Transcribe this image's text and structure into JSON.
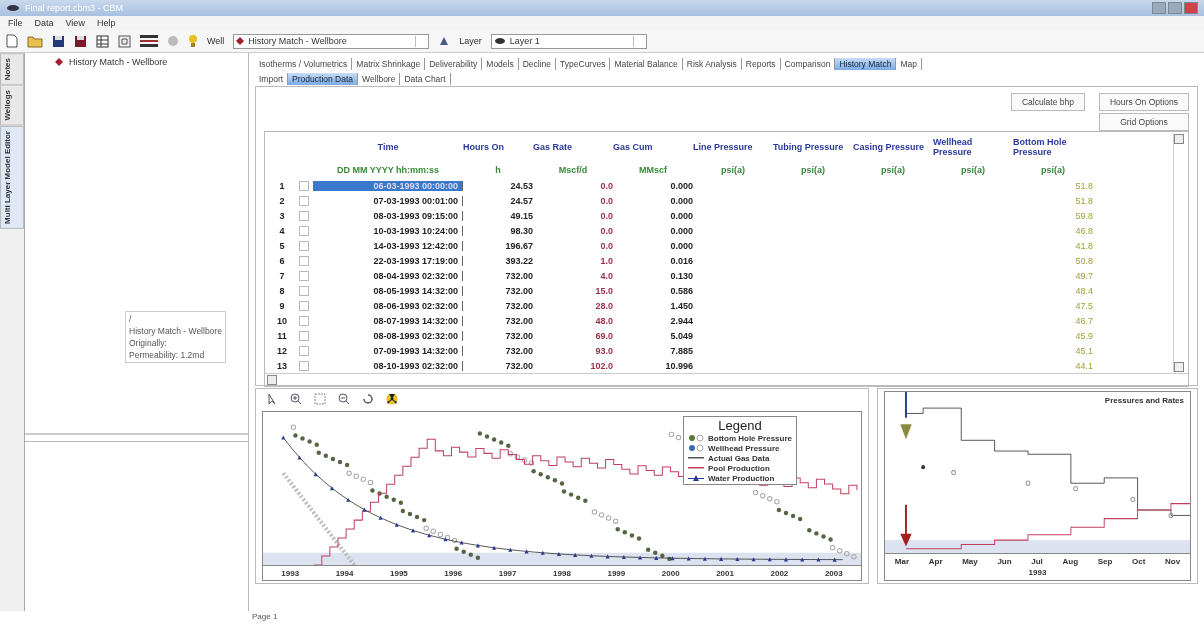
{
  "window": {
    "title": "Final report.cbm3 - CBM"
  },
  "menu": [
    "File",
    "Data",
    "View",
    "Help"
  ],
  "well_bar": {
    "well_label": "Well",
    "well_value": "History Match - Wellbore",
    "layer_label": "Layer",
    "layer_value": "Layer 1"
  },
  "side_tabs": [
    {
      "label": "Notes",
      "selected": false
    },
    {
      "label": "Wellogs",
      "selected": false
    },
    {
      "label": "Multi Layer Model Editor",
      "selected": true
    }
  ],
  "tree": {
    "items": [
      "History Match - Wellbore"
    ]
  },
  "tooltip": {
    "lines": [
      "/",
      "History Match - Wellbore",
      "Originally:",
      "Permeability: 1.2md"
    ]
  },
  "tabs": [
    {
      "label": "Isotherms / Volumetrics",
      "selected": false
    },
    {
      "label": "Matrix Shrinkage",
      "selected": false
    },
    {
      "label": "Deliverability",
      "selected": false
    },
    {
      "label": "Models",
      "selected": false
    },
    {
      "label": "Decline",
      "selected": false
    },
    {
      "label": "TypeCurves",
      "selected": false
    },
    {
      "label": "Material Balance",
      "selected": false
    },
    {
      "label": "Risk Analysis",
      "selected": false
    },
    {
      "label": "Reports",
      "selected": false
    },
    {
      "label": "Comparison",
      "selected": false
    },
    {
      "label": "History Match",
      "selected": true
    },
    {
      "label": "Map",
      "selected": false
    }
  ],
  "subtabs": [
    {
      "label": "Import",
      "selected": false
    },
    {
      "label": "Production Data",
      "selected": true
    },
    {
      "label": "Wellbore",
      "selected": false
    },
    {
      "label": "Data Chart",
      "selected": false
    }
  ],
  "buttons": [
    "Calculate bhp",
    "Hours On Options",
    "Grid Options"
  ],
  "table": {
    "columns": [
      {
        "name": "Time",
        "unit": "DD MM YYYY hh:mm:ss"
      },
      {
        "name": "Hours On",
        "unit": "h"
      },
      {
        "name": "Gas Rate",
        "unit": "Mscf/d"
      },
      {
        "name": "Gas Cum",
        "unit": "MMscf"
      },
      {
        "name": "Line Pressure",
        "unit": "psi(a)"
      },
      {
        "name": "Tubing Pressure",
        "unit": "psi(a)"
      },
      {
        "name": "Casing Pressure",
        "unit": "psi(a)"
      },
      {
        "name": "Wellhead Pressure",
        "unit": "psi(a)"
      },
      {
        "name": "Bottom Hole Pressure",
        "unit": "psi(a)"
      }
    ],
    "rows": [
      {
        "index": "1",
        "selected": true,
        "checked": false,
        "time": "06-03-1993 00:00:00",
        "hours": "24.53",
        "rate": "0.0",
        "cum": "0.000",
        "bhp": "51.8"
      },
      {
        "index": "2",
        "selected": false,
        "checked": false,
        "time": "07-03-1993 00:01:00",
        "hours": "24.57",
        "rate": "0.0",
        "cum": "0.000",
        "bhp": "51.8"
      },
      {
        "index": "3",
        "selected": false,
        "checked": false,
        "time": "08-03-1993 09:15:00",
        "hours": "49.15",
        "rate": "0.0",
        "cum": "0.000",
        "bhp": "59.8"
      },
      {
        "index": "4",
        "selected": false,
        "checked": false,
        "time": "10-03-1993 10:24:00",
        "hours": "98.30",
        "rate": "0.0",
        "cum": "0.000",
        "bhp": "46.8"
      },
      {
        "index": "5",
        "selected": false,
        "checked": false,
        "time": "14-03-1993 12:42:00",
        "hours": "196.67",
        "rate": "0.0",
        "cum": "0.000",
        "bhp": "41.8"
      },
      {
        "index": "6",
        "selected": false,
        "checked": false,
        "time": "22-03-1993 17:19:00",
        "hours": "393.22",
        "rate": "1.0",
        "cum": "0.016",
        "bhp": "50.8"
      },
      {
        "index": "7",
        "selected": false,
        "checked": false,
        "time": "08-04-1993 02:32:00",
        "hours": "732.00",
        "rate": "4.0",
        "cum": "0.130",
        "bhp": "49.7"
      },
      {
        "index": "8",
        "selected": false,
        "checked": false,
        "time": "08-05-1993 14:32:00",
        "hours": "732.00",
        "rate": "15.0",
        "cum": "0.586",
        "bhp": "48.4"
      },
      {
        "index": "9",
        "selected": false,
        "checked": false,
        "time": "08-06-1993 02:32:00",
        "hours": "732.00",
        "rate": "28.0",
        "cum": "1.450",
        "bhp": "47.5"
      },
      {
        "index": "10",
        "selected": false,
        "checked": false,
        "time": "08-07-1993 14:32:00",
        "hours": "732.00",
        "rate": "48.0",
        "cum": "2.944",
        "bhp": "46.7"
      },
      {
        "index": "11",
        "selected": false,
        "checked": false,
        "time": "08-08-1993 02:32:00",
        "hours": "732.00",
        "rate": "69.0",
        "cum": "5.049",
        "bhp": "45.9"
      },
      {
        "index": "12",
        "selected": false,
        "checked": false,
        "time": "07-09-1993 14:32:00",
        "hours": "732.00",
        "rate": "93.0",
        "cum": "7.885",
        "bhp": "45.1"
      },
      {
        "index": "13",
        "selected": false,
        "checked": false,
        "time": "08-10-1993 02:32:00",
        "hours": "732.00",
        "rate": "102.0",
        "cum": "10.996",
        "bhp": "44.1"
      }
    ]
  },
  "history_chart": {
    "legend_title": "Legend",
    "legend": [
      {
        "label": "Bottom Hole Pressure",
        "kind": "dots",
        "color": "#5a7a3a"
      },
      {
        "label": "Wellhead Pressure",
        "kind": "dots",
        "color": "#3a6ab0"
      },
      {
        "label": "Actual Gas Data",
        "kind": "line",
        "color": "#555555"
      },
      {
        "label": "Pool Production",
        "kind": "line",
        "color": "#c04060"
      },
      {
        "label": "Water Production",
        "kind": "marker",
        "color": "#2a3a90"
      }
    ],
    "x_labels": [
      "1993",
      "1994",
      "1995",
      "1996",
      "1997",
      "1998",
      "1999",
      "2000",
      "2001",
      "2002",
      "2003"
    ]
  },
  "rates_chart": {
    "title": "Pressures and Rates",
    "x_labels": [
      "Mar",
      "Apr",
      "May",
      "Jun",
      "Jul",
      "Aug",
      "Sep",
      "Oct",
      "Nov"
    ],
    "year": "1993"
  },
  "status_bar": {
    "page": "Page 1"
  }
}
